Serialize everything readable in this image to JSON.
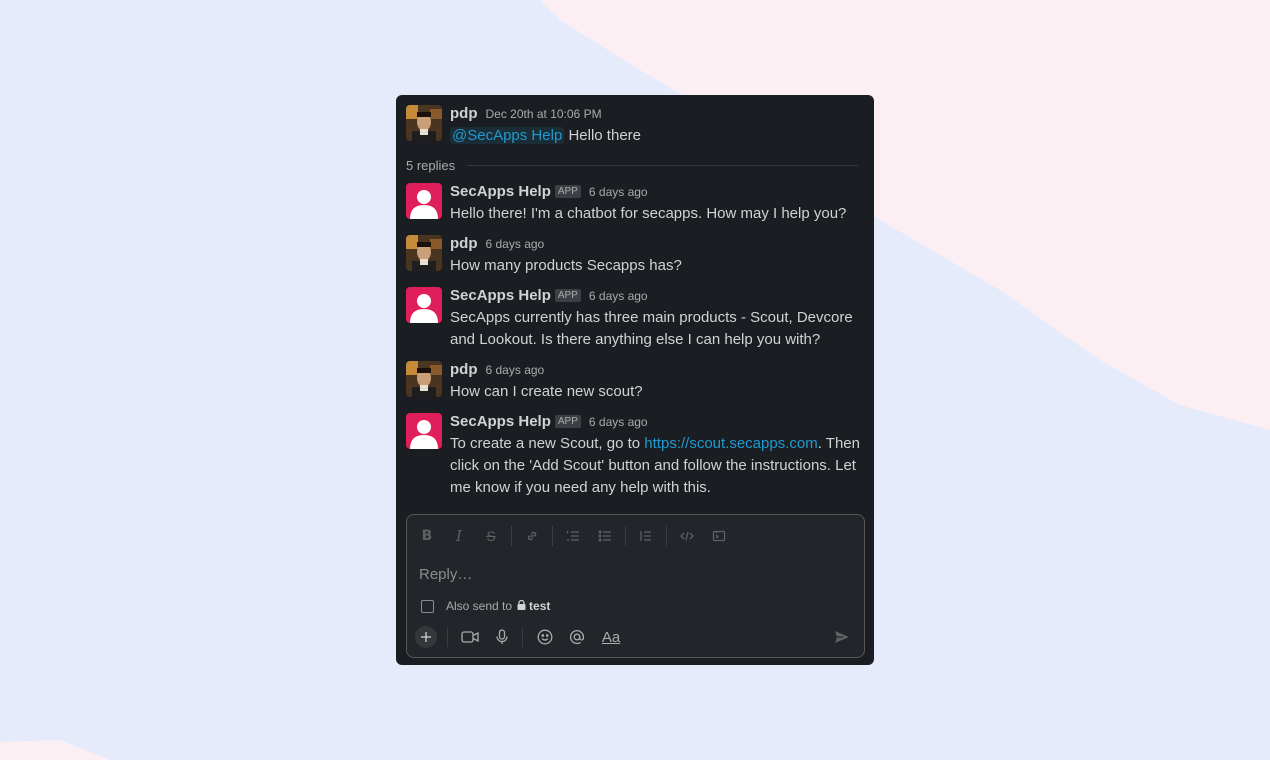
{
  "thread": {
    "parent": {
      "author": "pdp",
      "timestamp": "Dec 20th at 10:06 PM",
      "mention": "@SecApps Help",
      "text": "Hello there"
    },
    "replies_label": "5 replies",
    "replies": [
      {
        "author": "SecApps Help",
        "badge": "APP",
        "timestamp": "6 days ago",
        "lines": [
          "Hello there! I'm a chatbot for secapps. How may I help you?"
        ]
      },
      {
        "author": "pdp",
        "timestamp": "6 days ago",
        "lines": [
          "How many products Secapps has?"
        ]
      },
      {
        "author": "SecApps Help",
        "badge": "APP",
        "timestamp": "6 days ago",
        "lines": [
          "SecApps currently has three main products - Scout, Devcore",
          "and Lookout. Is there anything else I can help you with?"
        ]
      },
      {
        "author": "pdp",
        "timestamp": "6 days ago",
        "lines": [
          "How can I create new scout?"
        ]
      },
      {
        "author": "SecApps Help",
        "badge": "APP",
        "timestamp": "6 days ago",
        "text_before_link": "To create a new Scout, go to ",
        "link": "https://scout.secapps.com",
        "text_after_link": ". Then",
        "line2": "click on the 'Add Scout' button and follow the instructions. Let",
        "line3": "me know if you need any help with this."
      }
    ]
  },
  "composer": {
    "placeholder": "Reply…",
    "also_send_label": "Also send to",
    "channel": "test",
    "format_icons": [
      "bold-icon",
      "italic-icon",
      "strikethrough-icon",
      "link-icon",
      "ordered-list-icon",
      "bulleted-list-icon",
      "blockquote-icon",
      "code-icon",
      "code-block-icon"
    ],
    "bottom_icons": [
      "plus-icon",
      "video-icon",
      "microphone-icon",
      "emoji-icon",
      "mention-icon",
      "formatting-icon",
      "send-icon"
    ],
    "formatting_label": "Aa"
  },
  "colors": {
    "panel_bg": "#1a1d21",
    "link": "#1d9bd1",
    "bot_avatar": "#e01e5a"
  }
}
